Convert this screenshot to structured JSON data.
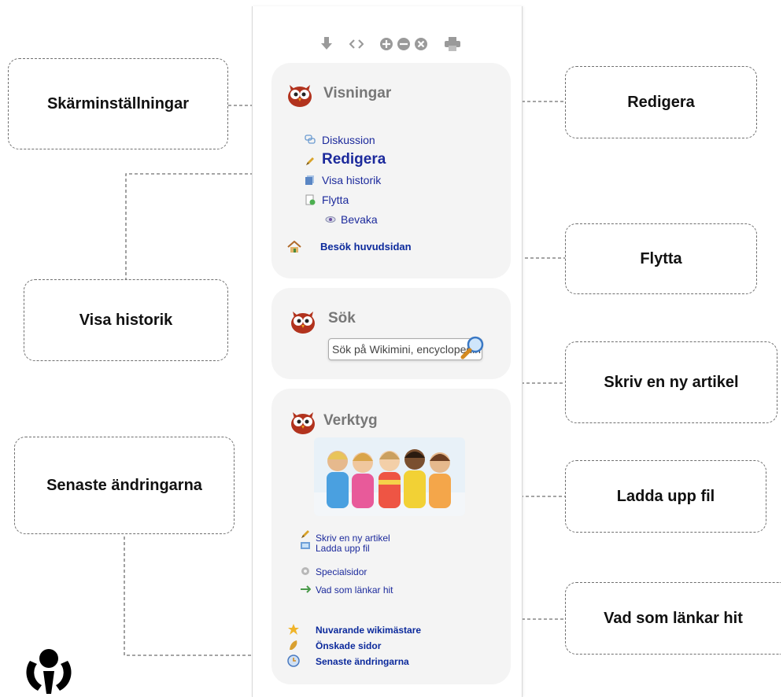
{
  "callouts": {
    "skarminstallningar": "Skärminställningar",
    "redigera": "Redigera",
    "flytta": "Flytta",
    "visa_historik": "Visa historik",
    "skriv_artikel": "Skriv en ny artikel",
    "senaste_andringarna": "Senaste ändringarna",
    "ladda_upp": "Ladda upp fil",
    "vad_lankar": "Vad som länkar hit"
  },
  "toolbar": {
    "icons": [
      "download-icon",
      "code-icon",
      "zoom-in-icon",
      "zoom-out-icon",
      "reset-icon",
      "print-icon"
    ]
  },
  "visningar": {
    "title": "Visningar",
    "items": {
      "diskussion": "Diskussion",
      "redigera": "Redigera",
      "visa_historik": "Visa historik",
      "flytta": "Flytta",
      "bevaka": "Bevaka"
    },
    "home_link": "Besök huvudsidan"
  },
  "sok": {
    "title": "Sök",
    "placeholder": "Sök på Wikimini, encyclopedin"
  },
  "verktyg": {
    "title": "Verktyg",
    "items": {
      "skriv": "Skriv en ny artikel",
      "ladda": "Ladda upp fil",
      "special": "Specialsidor",
      "vad": "Vad som länkar hit"
    },
    "extra": {
      "wikimastare": "Nuvarande wikimästare",
      "onskade": "Önskade sidor",
      "senaste": "Senaste ändringarna"
    }
  },
  "colors": {
    "link": "#1c2a9c",
    "box_bg": "#f4f4f4",
    "title_gray": "#777777",
    "dash": "#6f6f6f"
  }
}
